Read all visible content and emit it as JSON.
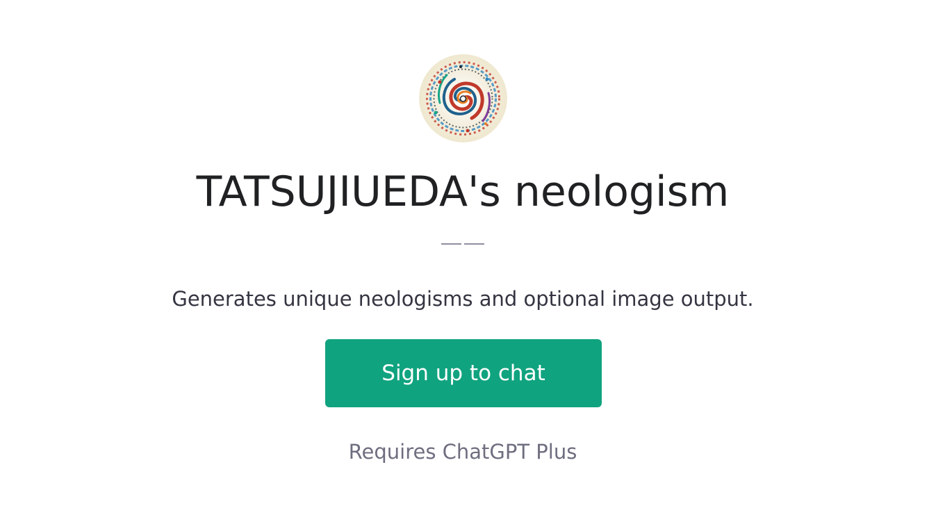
{
  "gpt": {
    "avatar_icon": "swirl-artwork-avatar",
    "title": "TATSUJIUEDA's neologism",
    "description": "Generates unique neologisms and optional image output."
  },
  "actions": {
    "signup_label": "Sign up to chat"
  },
  "footer": {
    "requirement": "Requires ChatGPT Plus"
  },
  "colors": {
    "accent": "#10a37f",
    "title": "#202123",
    "body": "#343541",
    "muted": "#6e6e80"
  }
}
